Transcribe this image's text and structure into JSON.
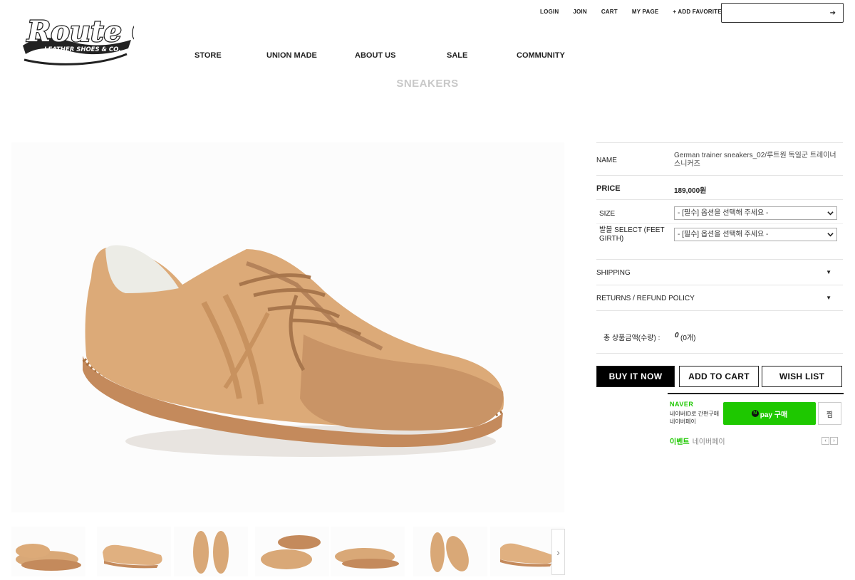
{
  "logo": {
    "line1": "Route One",
    "line2": "LEATHER SHOES & CO."
  },
  "util_nav": [
    "LOGIN",
    "JOIN",
    "CART",
    "MY PAGE",
    "+ ADD FAVORITE"
  ],
  "search": {
    "placeholder": "",
    "arrow": "➔"
  },
  "main_nav": [
    "STORE",
    "UNION MADE",
    "ABOUT US",
    "SALE",
    "COMMUNITY"
  ],
  "category_title": "SNEAKERS",
  "product": {
    "name_label": "NAME",
    "name": "German trainer sneakers_02/루트원 독일군 트레이너 스니커즈",
    "price_label": "PRICE",
    "price": "189,000원",
    "size_label": "SIZE",
    "size_option": "- [필수] 옵션을 선택해 주세요 -",
    "girth_label": "발볼 SELECT (FEET GIRTH)",
    "girth_option": "- [필수] 옵션을 선택해 주세요 -",
    "shipping_label": "SHIPPING",
    "returns_label": "RETURNS / REFUND POLICY",
    "total_label": "총 상품금액(수량) :",
    "total_value": "0",
    "total_count": "(0개)"
  },
  "buttons": {
    "buy_now": "BUY IT NOW",
    "add_to_cart": "ADD TO CART",
    "wish_list": "WISH LIST"
  },
  "npay": {
    "brand": "NAVER",
    "sub": "네이버ID로 간편구매 네이버페이",
    "pay_label": "pay 구매",
    "n_mark": "N",
    "zzim": "찜",
    "event_tag": "이벤트",
    "event_text": "네이버페이",
    "prev": "‹",
    "next": "›"
  },
  "thumb_next": "›",
  "colors": {
    "accent_green": "#1ec800",
    "dark": "#000000",
    "muted_title": "#c8c8c8",
    "leather": "#d9a877",
    "sole": "#c48a5c"
  }
}
